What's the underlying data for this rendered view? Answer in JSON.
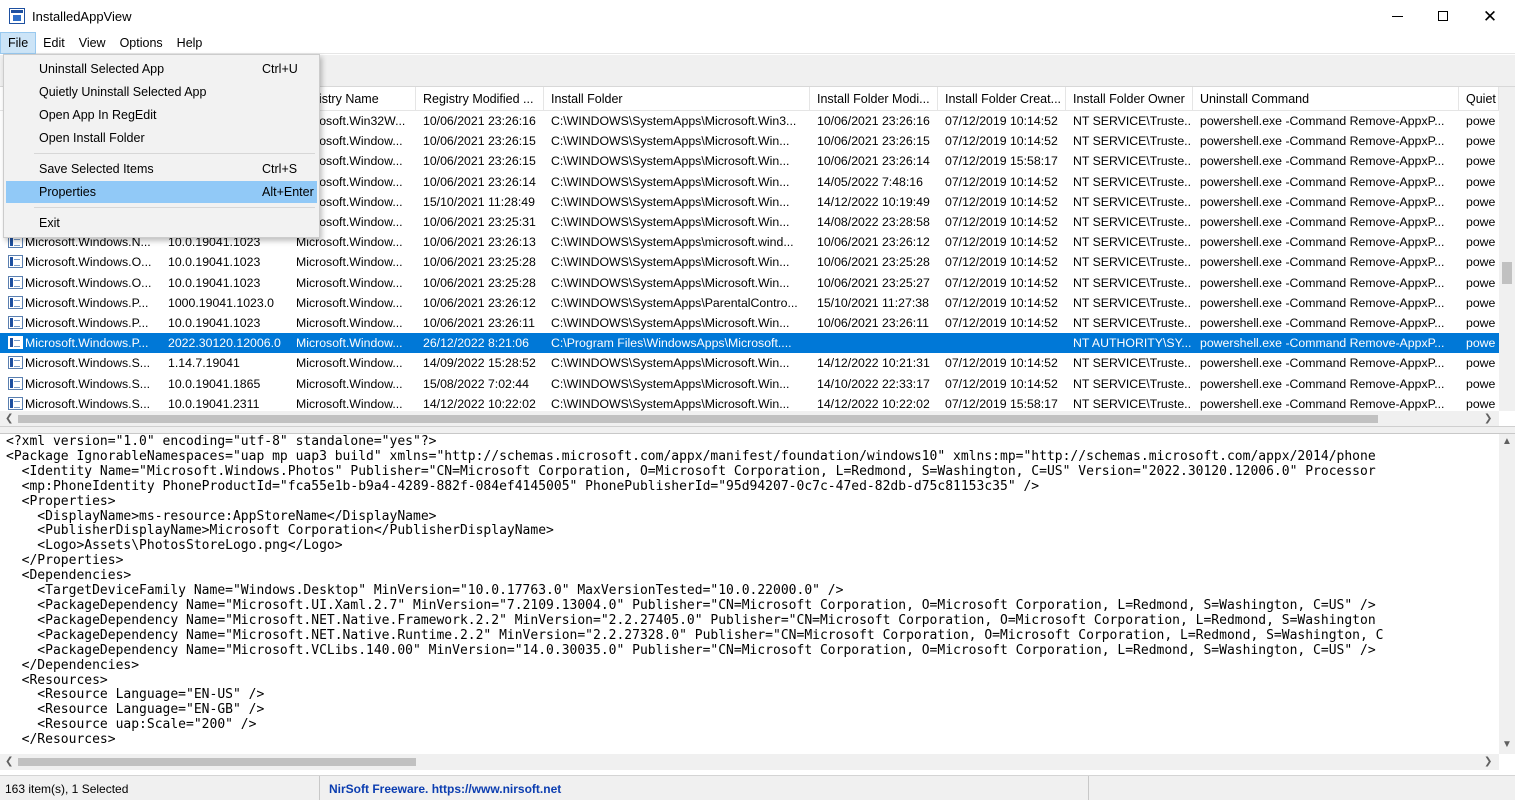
{
  "window": {
    "title": "InstalledAppView"
  },
  "menubar": [
    "File",
    "Edit",
    "View",
    "Options",
    "Help"
  ],
  "file_menu": {
    "groups": [
      [
        {
          "label": "Uninstall Selected App",
          "shortcut": "Ctrl+U"
        },
        {
          "label": "Quietly Uninstall Selected App",
          "shortcut": ""
        },
        {
          "label": "Open App In RegEdit",
          "shortcut": ""
        },
        {
          "label": "Open Install Folder",
          "shortcut": ""
        }
      ],
      [
        {
          "label": "Save Selected Items",
          "shortcut": "Ctrl+S"
        },
        {
          "label": "Properties",
          "shortcut": "Alt+Enter"
        }
      ],
      [
        {
          "label": "Exit",
          "shortcut": ""
        }
      ]
    ],
    "highlighted": "Properties"
  },
  "list": {
    "columns": [
      "",
      "",
      "Registry Name",
      "Registry Modified ...",
      "Install Folder",
      "Install Folder Modi...",
      "Install Folder Creat...",
      "Install Folder Owner",
      "Uninstall Command",
      "Quiet"
    ],
    "selected_index": 11,
    "rows": [
      [
        "",
        "",
        "Microsoft.Win32W...",
        "10/06/2021 23:26:16",
        "C:\\WINDOWS\\SystemApps\\Microsoft.Win3...",
        "10/06/2021 23:26:16",
        "07/12/2019 10:14:52",
        "NT SERVICE\\Truste...",
        "powershell.exe -Command Remove-AppxP...",
        "powe"
      ],
      [
        "",
        "",
        "Microsoft.Window...",
        "10/06/2021 23:26:15",
        "C:\\WINDOWS\\SystemApps\\Microsoft.Win...",
        "10/06/2021 23:26:15",
        "07/12/2019 10:14:52",
        "NT SERVICE\\Truste...",
        "powershell.exe -Command Remove-AppxP...",
        "powe"
      ],
      [
        "",
        "",
        "Microsoft.Window...",
        "10/06/2021 23:26:15",
        "C:\\WINDOWS\\SystemApps\\Microsoft.Win...",
        "10/06/2021 23:26:14",
        "07/12/2019 15:58:17",
        "NT SERVICE\\Truste...",
        "powershell.exe -Command Remove-AppxP...",
        "powe"
      ],
      [
        "",
        "",
        "Microsoft.Window...",
        "10/06/2021 23:26:14",
        "C:\\WINDOWS\\SystemApps\\Microsoft.Win...",
        "14/05/2022 7:48:16",
        "07/12/2019 10:14:52",
        "NT SERVICE\\Truste...",
        "powershell.exe -Command Remove-AppxP...",
        "powe"
      ],
      [
        "",
        "",
        "Microsoft.Window...",
        "15/10/2021 11:28:49",
        "C:\\WINDOWS\\SystemApps\\Microsoft.Win...",
        "14/12/2022 10:19:49",
        "07/12/2019 10:14:52",
        "NT SERVICE\\Truste...",
        "powershell.exe -Command Remove-AppxP...",
        "powe"
      ],
      [
        "",
        "",
        "Microsoft.Window...",
        "10/06/2021 23:25:31",
        "C:\\WINDOWS\\SystemApps\\Microsoft.Win...",
        "14/08/2022 23:28:58",
        "07/12/2019 10:14:52",
        "NT SERVICE\\Truste...",
        "powershell.exe -Command Remove-AppxP...",
        "powe"
      ],
      [
        "Microsoft.Windows.N...",
        "10.0.19041.1023",
        "Microsoft.Window...",
        "10/06/2021 23:26:13",
        "C:\\WINDOWS\\SystemApps\\microsoft.wind...",
        "10/06/2021 23:26:12",
        "07/12/2019 10:14:52",
        "NT SERVICE\\Truste...",
        "powershell.exe -Command Remove-AppxP...",
        "powe"
      ],
      [
        "Microsoft.Windows.O...",
        "10.0.19041.1023",
        "Microsoft.Window...",
        "10/06/2021 23:25:28",
        "C:\\WINDOWS\\SystemApps\\Microsoft.Win...",
        "10/06/2021 23:25:28",
        "07/12/2019 10:14:52",
        "NT SERVICE\\Truste...",
        "powershell.exe -Command Remove-AppxP...",
        "powe"
      ],
      [
        "Microsoft.Windows.O...",
        "10.0.19041.1023",
        "Microsoft.Window...",
        "10/06/2021 23:25:28",
        "C:\\WINDOWS\\SystemApps\\Microsoft.Win...",
        "10/06/2021 23:25:27",
        "07/12/2019 10:14:52",
        "NT SERVICE\\Truste...",
        "powershell.exe -Command Remove-AppxP...",
        "powe"
      ],
      [
        "Microsoft.Windows.P...",
        "1000.19041.1023.0",
        "Microsoft.Window...",
        "10/06/2021 23:26:12",
        "C:\\WINDOWS\\SystemApps\\ParentalContro...",
        "15/10/2021 11:27:38",
        "07/12/2019 10:14:52",
        "NT SERVICE\\Truste...",
        "powershell.exe -Command Remove-AppxP...",
        "powe"
      ],
      [
        "Microsoft.Windows.P...",
        "10.0.19041.1023",
        "Microsoft.Window...",
        "10/06/2021 23:26:11",
        "C:\\WINDOWS\\SystemApps\\Microsoft.Win...",
        "10/06/2021 23:26:11",
        "07/12/2019 10:14:52",
        "NT SERVICE\\Truste...",
        "powershell.exe -Command Remove-AppxP...",
        "powe"
      ],
      [
        "Microsoft.Windows.P...",
        "2022.30120.12006.0",
        "Microsoft.Window...",
        "26/12/2022 8:21:06",
        "C:\\Program Files\\WindowsApps\\Microsoft....",
        "",
        "",
        "NT AUTHORITY\\SY...",
        "powershell.exe -Command Remove-AppxP...",
        "powe"
      ],
      [
        "Microsoft.Windows.S...",
        "1.14.7.19041",
        "Microsoft.Window...",
        "14/09/2022 15:28:52",
        "C:\\WINDOWS\\SystemApps\\Microsoft.Win...",
        "14/12/2022 10:21:31",
        "07/12/2019 10:14:52",
        "NT SERVICE\\Truste...",
        "powershell.exe -Command Remove-AppxP...",
        "powe"
      ],
      [
        "Microsoft.Windows.S...",
        "10.0.19041.1865",
        "Microsoft.Window...",
        "15/08/2022 7:02:44",
        "C:\\WINDOWS\\SystemApps\\Microsoft.Win...",
        "14/10/2022 22:33:17",
        "07/12/2019 10:14:52",
        "NT SERVICE\\Truste...",
        "powershell.exe -Command Remove-AppxP...",
        "powe"
      ],
      [
        "Microsoft.Windows.S...",
        "10.0.19041.2311",
        "Microsoft.Window...",
        "14/12/2022 10:22:02",
        "C:\\WINDOWS\\SystemApps\\Microsoft.Win...",
        "14/12/2022 10:22:02",
        "07/12/2019 15:58:17",
        "NT SERVICE\\Truste...",
        "powershell.exe -Command Remove-AppxP...",
        "powe"
      ]
    ]
  },
  "xml_lines": [
    "<?xml version=\"1.0\" encoding=\"utf-8\" standalone=\"yes\"?>",
    "<Package IgnorableNamespaces=\"uap mp uap3 build\" xmlns=\"http://schemas.microsoft.com/appx/manifest/foundation/windows10\" xmlns:mp=\"http://schemas.microsoft.com/appx/2014/phone",
    "  <Identity Name=\"Microsoft.Windows.Photos\" Publisher=\"CN=Microsoft Corporation, O=Microsoft Corporation, L=Redmond, S=Washington, C=US\" Version=\"2022.30120.12006.0\" Processor",
    "  <mp:PhoneIdentity PhoneProductId=\"fca55e1b-b9a4-4289-882f-084ef4145005\" PhonePublisherId=\"95d94207-0c7c-47ed-82db-d75c81153c35\" />",
    "  <Properties>",
    "    <DisplayName>ms-resource:AppStoreName</DisplayName>",
    "    <PublisherDisplayName>Microsoft Corporation</PublisherDisplayName>",
    "    <Logo>Assets\\PhotosStoreLogo.png</Logo>",
    "  </Properties>",
    "  <Dependencies>",
    "    <TargetDeviceFamily Name=\"Windows.Desktop\" MinVersion=\"10.0.17763.0\" MaxVersionTested=\"10.0.22000.0\" />",
    "    <PackageDependency Name=\"Microsoft.UI.Xaml.2.7\" MinVersion=\"7.2109.13004.0\" Publisher=\"CN=Microsoft Corporation, O=Microsoft Corporation, L=Redmond, S=Washington, C=US\" />",
    "    <PackageDependency Name=\"Microsoft.NET.Native.Framework.2.2\" MinVersion=\"2.2.27405.0\" Publisher=\"CN=Microsoft Corporation, O=Microsoft Corporation, L=Redmond, S=Washington",
    "    <PackageDependency Name=\"Microsoft.NET.Native.Runtime.2.2\" MinVersion=\"2.2.27328.0\" Publisher=\"CN=Microsoft Corporation, O=Microsoft Corporation, L=Redmond, S=Washington, C",
    "    <PackageDependency Name=\"Microsoft.VCLibs.140.00\" MinVersion=\"14.0.30035.0\" Publisher=\"CN=Microsoft Corporation, O=Microsoft Corporation, L=Redmond, S=Washington, C=US\" />",
    "  </Dependencies>",
    "  <Resources>",
    "    <Resource Language=\"EN-US\" />",
    "    <Resource Language=\"EN-GB\" />",
    "    <Resource uap:Scale=\"200\" />",
    "  </Resources>"
  ],
  "status": {
    "count": "163 item(s), 1 Selected",
    "credit": "NirSoft Freeware. https://www.nirsoft.net"
  },
  "colors": {
    "selection": "#0078d7",
    "menu_highlight": "#91c9f7",
    "link": "#0b3db0"
  }
}
